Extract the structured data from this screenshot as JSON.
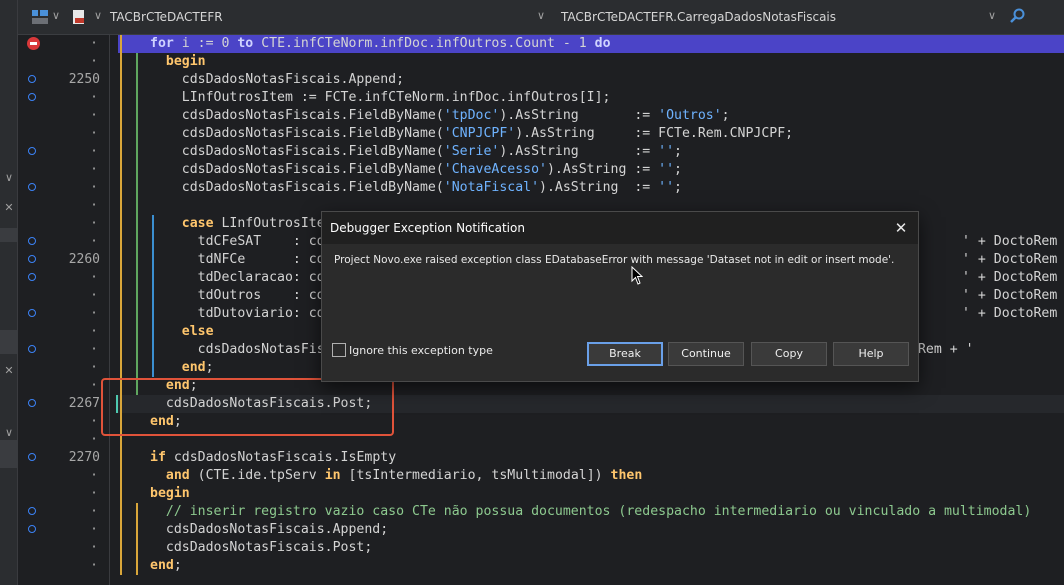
{
  "toolbar": {
    "file_combo": "TACBrCTeDACTEFR",
    "method_combo": "TACBrCTeDACTEFR.CarregaDadosNotasFiscais"
  },
  "left_strip": {
    "ticks": [
      "∨",
      "✕",
      "∨",
      "✕"
    ]
  },
  "gutter": {
    "line_numbers": {
      "2": "2250",
      "12": "2260",
      "20": "2267",
      "23": "2270"
    }
  },
  "code": {
    "lines": [
      [
        [
          "kw2",
          "for "
        ],
        [
          "",
          "i := "
        ],
        [
          "",
          "0"
        ],
        [
          "kw2",
          " to "
        ],
        [
          "",
          "CTE.infCTeNorm.infDoc.infOutros.Count - 1 "
        ],
        [
          "kw2",
          "do"
        ]
      ],
      [
        [
          "kw",
          "  begin"
        ]
      ],
      [
        [
          "",
          "    cdsDadosNotasFiscais.Append;"
        ]
      ],
      [
        [
          "",
          "    LInfOutrosItem := FCTe.infCTeNorm.infDoc.infOutros[I];"
        ]
      ],
      [
        [
          "",
          "    cdsDadosNotasFiscais.FieldByName("
        ],
        [
          "str",
          "'tpDoc'"
        ],
        [
          "",
          ").AsString       := "
        ],
        [
          "str",
          "'Outros'"
        ],
        [
          "",
          ";"
        ]
      ],
      [
        [
          "",
          "    cdsDadosNotasFiscais.FieldByName("
        ],
        [
          "str",
          "'CNPJCPF'"
        ],
        [
          "",
          ").AsString     := FCTe.Rem.CNPJCPF;"
        ]
      ],
      [
        [
          "",
          "    cdsDadosNotasFiscais.FieldByName("
        ],
        [
          "str",
          "'Serie'"
        ],
        [
          "",
          ").AsString       := "
        ],
        [
          "str",
          "''"
        ],
        [
          "",
          ";"
        ]
      ],
      [
        [
          "",
          "    cdsDadosNotasFiscais.FieldByName("
        ],
        [
          "str",
          "'ChaveAcesso'"
        ],
        [
          "",
          ").AsString := "
        ],
        [
          "str",
          "''"
        ],
        [
          "",
          ";"
        ]
      ],
      [
        [
          "",
          "    cdsDadosNotasFiscais.FieldByName("
        ],
        [
          "str",
          "'NotaFiscal'"
        ],
        [
          "",
          ").AsString  := "
        ],
        [
          "str",
          "''"
        ],
        [
          "",
          ";"
        ]
      ],
      [
        [
          "",
          ""
        ]
      ],
      [
        [
          "kw",
          "    case "
        ],
        [
          "",
          "LInfOutrosItem."
        ]
      ],
      [
        [
          "",
          "      tdCFeSAT    : cdsD"
        ]
      ],
      [
        [
          "",
          "      tdNFCe      : cdsD"
        ]
      ],
      [
        [
          "",
          "      tdDeclaracao: cdsD"
        ]
      ],
      [
        [
          "",
          "      tdOutros    : cdsD"
        ]
      ],
      [
        [
          "",
          "      tdDutoviario: cdsD"
        ]
      ],
      [
        [
          "kw",
          "    else"
        ]
      ],
      [
        [
          "",
          "      cdsDadosNotasFisca"
        ]
      ],
      [
        [
          "kw",
          "    end"
        ],
        [
          "",
          ";"
        ]
      ],
      [
        [
          "kw",
          "  end"
        ],
        [
          "",
          ";"
        ]
      ],
      [
        [
          "",
          "  cdsDadosNotasFiscais.Post;"
        ]
      ],
      [
        [
          "kw",
          "end"
        ],
        [
          "",
          ";"
        ]
      ],
      [
        [
          "",
          ""
        ]
      ],
      [
        [
          "kw",
          "if "
        ],
        [
          "",
          "cdsDadosNotasFiscais.IsEmpty"
        ]
      ],
      [
        [
          "kw",
          "  and "
        ],
        [
          "",
          "(CTE.ide.tpServ "
        ],
        [
          "kw",
          "in "
        ],
        [
          "",
          "[tsIntermediario, tsMultimodal]) "
        ],
        [
          "kw",
          "then"
        ]
      ],
      [
        [
          "kw",
          "begin"
        ]
      ],
      [
        [
          "cmt",
          "  // inserir registro vazio caso CTe não possua documentos (redespacho intermediario ou vinculado a multimodal)"
        ]
      ],
      [
        [
          "",
          "  cdsDadosNotasFiscais.Append;"
        ]
      ],
      [
        [
          "",
          "  cdsDadosNotasFiscais.Post;"
        ]
      ],
      [
        [
          "kw",
          "end"
        ],
        [
          "",
          ";"
        ]
      ]
    ],
    "right_fragments": [
      "' + DoctoRem",
      "' + DoctoRem",
      "' + DoctoRem",
      "' + DoctoRem",
      "' + DoctoRem",
      "oRem + '"
    ]
  },
  "dialog": {
    "title": "Debugger Exception Notification",
    "message": "Project Novo.exe raised exception class EDatabaseError with message 'Dataset not in edit or insert mode'.",
    "checkbox_label": "Ignore this exception type",
    "buttons": [
      "Break",
      "Continue",
      "Copy",
      "Help"
    ]
  }
}
